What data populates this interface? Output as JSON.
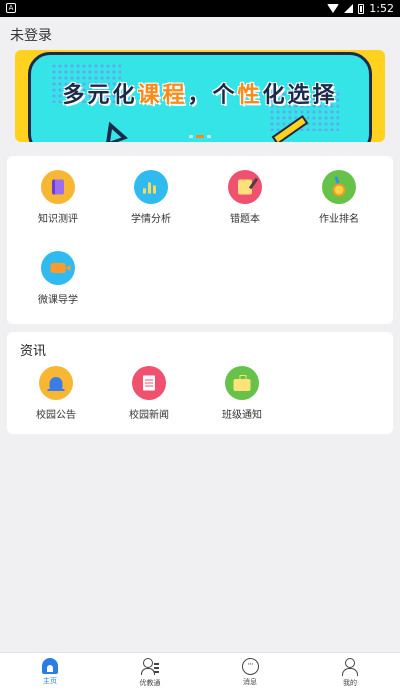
{
  "status_bar": {
    "time": "1:52",
    "left_icon": "a-icon",
    "icons": [
      "wifi-icon",
      "signal-icon",
      "battery-icon"
    ]
  },
  "header": {
    "login_status": "未登录"
  },
  "banner": {
    "title_parts": [
      "多元化",
      "课程",
      "，个",
      "性",
      "化选择"
    ],
    "page_count": 3,
    "active_page": 2
  },
  "menu": {
    "items": [
      {
        "label": "知识测评",
        "icon": "book-icon",
        "color": "#f8b733"
      },
      {
        "label": "学情分析",
        "icon": "bar-chart-icon",
        "color": "#2fbaf0"
      },
      {
        "label": "错题本",
        "icon": "notebook-icon",
        "color": "#f0516e"
      },
      {
        "label": "作业排名",
        "icon": "medal-icon",
        "color": "#67c24a"
      },
      {
        "label": "微课导学",
        "icon": "video-camera-icon",
        "color": "#2fbaf0"
      }
    ]
  },
  "news": {
    "title": "资讯",
    "items": [
      {
        "label": "校园公告",
        "icon": "bell-icon",
        "color": "#f8b733"
      },
      {
        "label": "校园新闻",
        "icon": "newspaper-icon",
        "color": "#f0516e"
      },
      {
        "label": "班级通知",
        "icon": "bulletin-board-icon",
        "color": "#67c24a"
      }
    ]
  },
  "bottom_nav": {
    "items": [
      {
        "label": "主页",
        "icon": "home-icon",
        "active": true
      },
      {
        "label": "优教通",
        "icon": "user-list-icon",
        "active": false
      },
      {
        "label": "消息",
        "icon": "chat-icon",
        "active": false
      },
      {
        "label": "我的",
        "icon": "profile-icon",
        "active": false
      }
    ]
  },
  "colors": {
    "accent": "#2a7de1",
    "banner_yellow": "#ffd21f",
    "banner_cyan": "#35e4e6",
    "banner_highlight": "#ff8a1a"
  }
}
